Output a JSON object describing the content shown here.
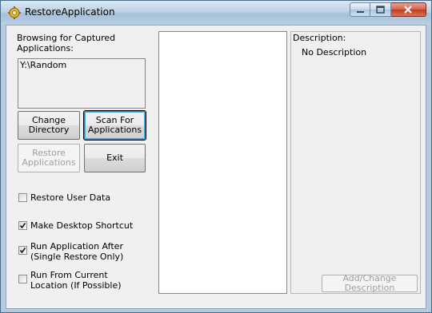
{
  "window": {
    "title": "RestoreApplication",
    "icon": "gear-icon"
  },
  "browse": {
    "label": "Browsing for Captured Applications:",
    "items": [
      "Y:\\Random"
    ]
  },
  "buttons": {
    "change_directory": "Change Directory",
    "scan_for_applications": "Scan For Applications",
    "restore_applications": "Restore Applications",
    "exit": "Exit",
    "add_change_description": "Add/Change Description"
  },
  "options": [
    {
      "label": "Restore User Data",
      "checked": false
    },
    {
      "label": "Make Desktop Shortcut",
      "checked": true
    },
    {
      "label": "Run Application After (Single Restore Only)",
      "checked": true
    },
    {
      "label": "Run From Current Location (If Possible)",
      "checked": false
    }
  ],
  "description": {
    "header": "Description:",
    "text": "No Description"
  }
}
